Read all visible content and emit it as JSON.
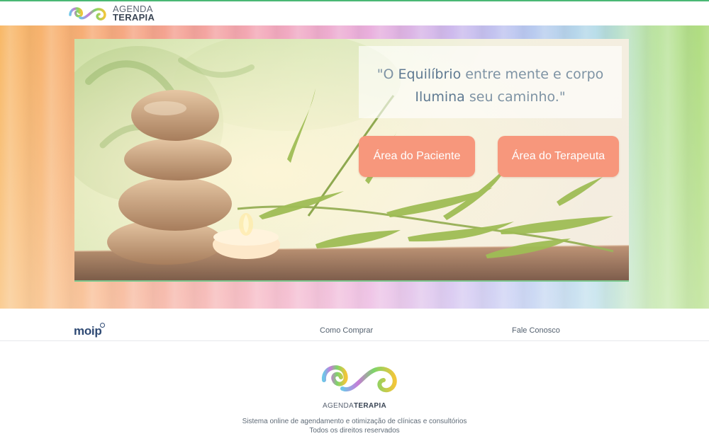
{
  "header": {
    "brand_line1": "AGENDA",
    "brand_line2": "TERAPIA",
    "border_color": "#4ab874"
  },
  "hero": {
    "quote_line1_a": "\"O ",
    "quote_line1_b": "Equilíbrio",
    "quote_line1_c": " entre mente e corpo",
    "quote_line2_a": "Ilumina",
    "quote_line2_b": " seu caminho.\"",
    "button_patient": "Área do Paciente",
    "button_therapist": "Área do Terapeuta",
    "button_color": "#f7977c"
  },
  "footer_nav": {
    "moip_label": "moip",
    "link_how_to_buy": "Como Comprar",
    "link_contact": "Fale Conosco"
  },
  "footer": {
    "brand_a": "AGENDA",
    "brand_b": "TERAPIA",
    "tagline": "Sistema online de agendamento e otimização de clínicas e consultórios",
    "rights": "Todos os direitos reservados"
  },
  "icons": [
    "brand-swirl-logo",
    "moip-logo"
  ]
}
